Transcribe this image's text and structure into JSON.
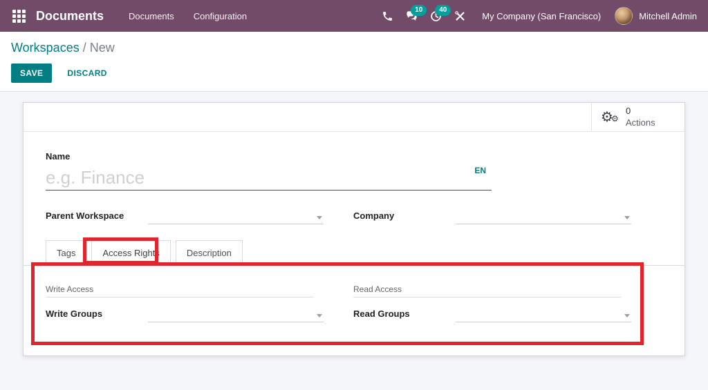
{
  "colors": {
    "nav-bg": "#714b67",
    "teal": "#017e84",
    "badge": "#00a09d",
    "annotation": "#e0252c"
  },
  "navbar": {
    "brand": "Documents",
    "menus": [
      {
        "label": "Documents"
      },
      {
        "label": "Configuration"
      }
    ],
    "systray": {
      "messages_badge": "10",
      "activities_badge": "40",
      "company": "My Company (San Francisco)",
      "user": "Mitchell Admin"
    }
  },
  "control_panel": {
    "breadcrumb": {
      "parent": "Workspaces",
      "separator": "/",
      "current": "New"
    },
    "save": "SAVE",
    "discard": "DISCARD"
  },
  "form": {
    "stat_button": {
      "count": "0",
      "label": "Actions"
    },
    "name_field": {
      "label": "Name",
      "placeholder": "e.g. Finance",
      "value": "",
      "lang": "EN"
    },
    "parent_field": {
      "label": "Parent Workspace",
      "value": ""
    },
    "company_field": {
      "label": "Company",
      "value": ""
    },
    "tabs": [
      {
        "label": "Tags"
      },
      {
        "label": "Access Rights"
      },
      {
        "label": "Description"
      }
    ],
    "active_tab": "Access Rights",
    "access_tab": {
      "write_section": "Write Access",
      "write_groups_label": "Write Groups",
      "write_groups_value": "",
      "read_section": "Read Access",
      "read_groups_label": "Read Groups",
      "read_groups_value": ""
    }
  },
  "icons": {
    "gear": "⚙"
  }
}
